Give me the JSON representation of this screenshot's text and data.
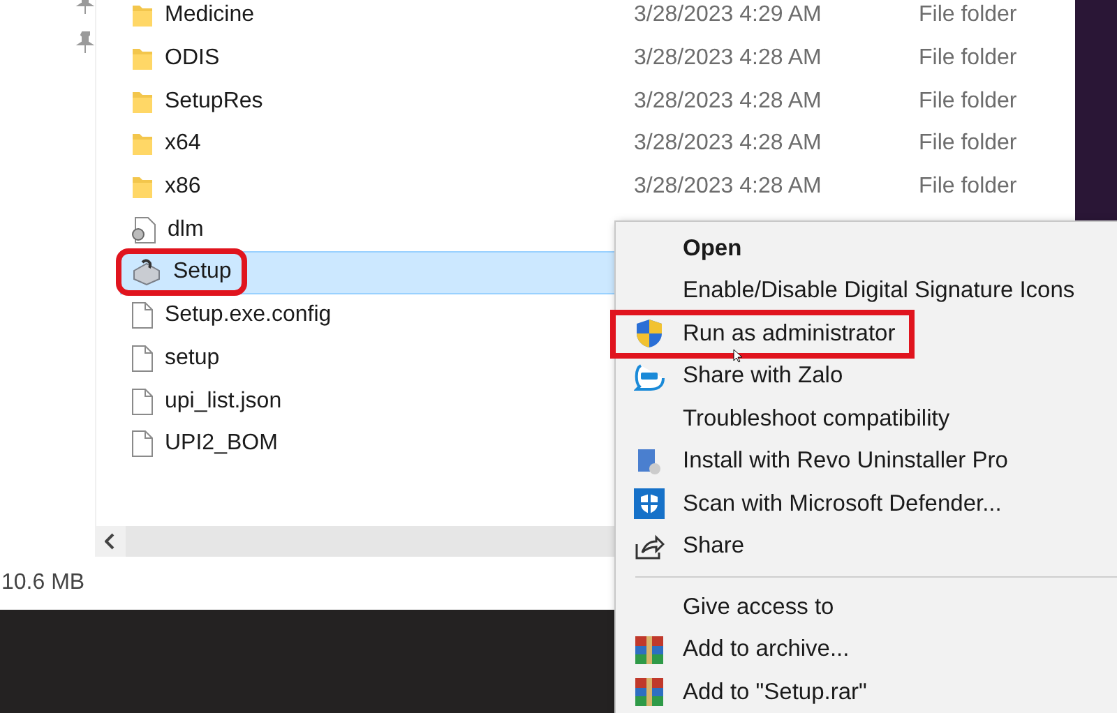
{
  "files": [
    {
      "name": "Medicine",
      "date": "3/28/2023 4:29 AM",
      "type": "File folder",
      "kind": "folder",
      "selected": false,
      "annotated": false
    },
    {
      "name": "ODIS",
      "date": "3/28/2023 4:28 AM",
      "type": "File folder",
      "kind": "folder",
      "selected": false,
      "annotated": false
    },
    {
      "name": "SetupRes",
      "date": "3/28/2023 4:28 AM",
      "type": "File folder",
      "kind": "folder",
      "selected": false,
      "annotated": false
    },
    {
      "name": "x64",
      "date": "3/28/2023 4:28 AM",
      "type": "File folder",
      "kind": "folder",
      "selected": false,
      "annotated": false
    },
    {
      "name": "x86",
      "date": "3/28/2023 4:28 AM",
      "type": "File folder",
      "kind": "folder",
      "selected": false,
      "annotated": false
    },
    {
      "name": "dlm",
      "kind": "config",
      "selected": false,
      "annotated": false
    },
    {
      "name": "Setup",
      "kind": "installer",
      "selected": true,
      "annotated": true
    },
    {
      "name": "Setup.exe.config",
      "kind": "file",
      "selected": false,
      "annotated": false
    },
    {
      "name": "setup",
      "kind": "file",
      "selected": false,
      "annotated": false
    },
    {
      "name": "upi_list.json",
      "kind": "file",
      "selected": false,
      "annotated": false
    },
    {
      "name": "UPI2_BOM",
      "kind": "file",
      "selected": false,
      "annotated": false
    }
  ],
  "status_bar": {
    "size": "10.6 MB"
  },
  "context_menu": {
    "groups": [
      [
        {
          "label": "Open",
          "kind": "plain",
          "default": true,
          "annotated": false
        },
        {
          "label": "Enable/Disable Digital Signature Icons",
          "kind": "plain",
          "default": false,
          "annotated": false
        },
        {
          "label": "Run as administrator",
          "kind": "shield",
          "default": false,
          "annotated": true
        },
        {
          "label": "Share with Zalo",
          "kind": "chat",
          "default": false,
          "annotated": false
        },
        {
          "label": "Troubleshoot compatibility",
          "kind": "plain",
          "default": false,
          "annotated": false
        },
        {
          "label": "Install with Revo Uninstaller Pro",
          "kind": "uninstaller",
          "default": false,
          "annotated": false
        },
        {
          "label": "Scan with Microsoft Defender...",
          "kind": "defender",
          "default": false,
          "annotated": false
        },
        {
          "label": "Share",
          "kind": "share",
          "default": false,
          "annotated": false
        }
      ],
      [
        {
          "label": "Give access to",
          "kind": "plain",
          "default": false,
          "annotated": false
        },
        {
          "label": "Add to archive...",
          "kind": "archive",
          "default": false,
          "annotated": false
        },
        {
          "label": "Add to \"Setup.rar\"",
          "kind": "archive",
          "default": false,
          "annotated": false
        }
      ]
    ]
  }
}
